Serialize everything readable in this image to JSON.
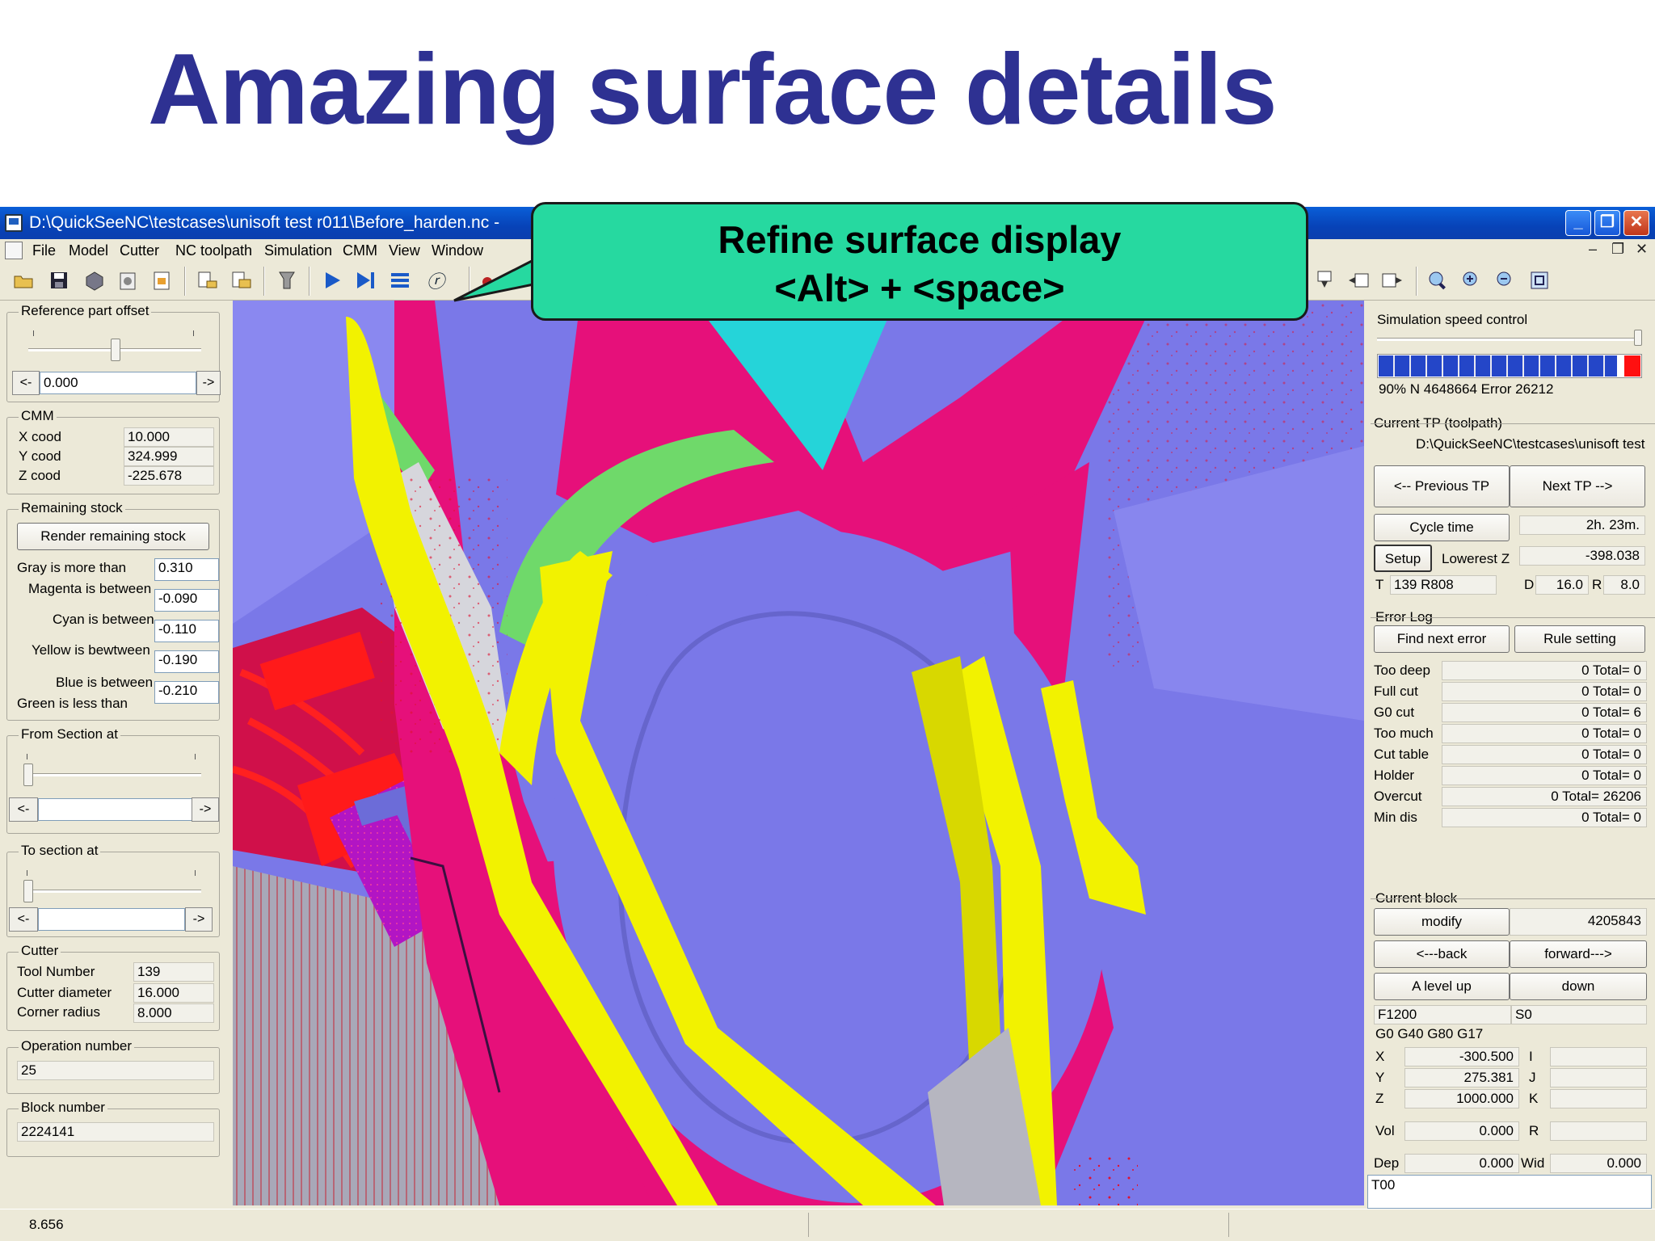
{
  "slide": {
    "title": "Amazing surface details"
  },
  "window": {
    "title": "D:\\QuickSeeNC\\testcases\\unisoft test r011\\Before_harden.nc -",
    "controls": {
      "minimize": "_",
      "restore": "❐",
      "close": "✕"
    }
  },
  "menu": [
    "File",
    "Model",
    "Cutter",
    "NC toolpath",
    "Simulation",
    "CMM",
    "View",
    "Window"
  ],
  "mdi_controls": {
    "minimize": "–",
    "restore": "❐",
    "close": "✕"
  },
  "callout": {
    "line1": "Refine surface display",
    "line2": "<Alt> + <space>"
  },
  "left": {
    "ref_offset": {
      "title": "Reference part offset",
      "value": "0.000",
      "left_arrow": "<-",
      "right_arrow": "->"
    },
    "cmm": {
      "title": "CMM",
      "rows": [
        {
          "label": "X cood",
          "value": "10.000"
        },
        {
          "label": "Y cood",
          "value": "324.999"
        },
        {
          "label": "Z cood",
          "value": "-225.678"
        }
      ]
    },
    "remaining": {
      "title": "Remaining stock",
      "button": "Render remaining stock",
      "rows": [
        {
          "label": "Gray is more than",
          "value": "0.310"
        },
        {
          "label": "Magenta is between",
          "value": "-0.090"
        },
        {
          "label": "Cyan is between",
          "value": "-0.110"
        },
        {
          "label": "Yellow is bewtween",
          "value": "-0.190"
        },
        {
          "label": "Blue is between",
          "value": "-0.210"
        },
        {
          "label": "Green is less than",
          "value": ""
        }
      ]
    },
    "from_section": {
      "title": "From Section at",
      "left_arrow": "<-",
      "right_arrow": "->"
    },
    "to_section": {
      "title": "To section at",
      "left_arrow": "<-",
      "right_arrow": "->"
    },
    "cutter": {
      "title": "Cutter",
      "rows": [
        {
          "label": "Tool Number",
          "value": "139"
        },
        {
          "label": "Cutter diameter",
          "value": "16.000"
        },
        {
          "label": "Corner radius",
          "value": "8.000"
        }
      ]
    },
    "operation": {
      "title": "Operation number",
      "value": "25"
    },
    "block": {
      "title": "Block number",
      "value": "2224141"
    }
  },
  "right": {
    "speed": {
      "title": "Simulation speed control",
      "status": "90%  N 4648664  Error 26212",
      "progress": 0.97
    },
    "current_tp": {
      "title": "Current TP (toolpath)",
      "path": "D:\\QuickSeeNC\\testcases\\unisoft test",
      "prev": "<-- Previous TP",
      "next": "Next TP -->"
    },
    "cycle_time": {
      "label": "Cycle time",
      "value": "2h. 23m."
    },
    "setup": "Setup",
    "lowest_z": {
      "label": "Lowerest Z",
      "value": "-398.038"
    },
    "tool_info": {
      "t": "T",
      "tool": "139  R808",
      "d_label": "D",
      "d": "16.0",
      "r_label": "R",
      "r": "8.0"
    },
    "error_log": {
      "title": "Error Log",
      "find": "Find next error",
      "rule": "Rule setting",
      "rows": [
        {
          "label": "Too deep",
          "value": "0 Total= 0"
        },
        {
          "label": "Full cut",
          "value": "0 Total= 0"
        },
        {
          "label": "G0 cut",
          "value": "0 Total= 6"
        },
        {
          "label": "Too much",
          "value": "0 Total= 0"
        },
        {
          "label": "Cut table",
          "value": "0 Total= 0"
        },
        {
          "label": "Holder",
          "value": "0 Total= 0"
        },
        {
          "label": "Overcut",
          "value": "0 Total= 26206"
        },
        {
          "label": "Min dis",
          "value": "0 Total= 0"
        }
      ]
    },
    "current_block": {
      "title": "Current block",
      "modify": "modify",
      "value": "4205843",
      "back": "<---back",
      "forward": "forward--->",
      "up": "A level up",
      "down": "down",
      "feed": "F1200",
      "speed": "S0",
      "gcodes": "G0  G40  G80  G17",
      "coords": [
        {
          "axis": "X",
          "value": "-300.500",
          "aux": "I"
        },
        {
          "axis": "Y",
          "value": "275.381",
          "aux": "J"
        },
        {
          "axis": "Z",
          "value": "1000.000",
          "aux": "K"
        }
      ],
      "vol_label": "Vol",
      "vol": "0.000",
      "r_label": "R",
      "dep_label": "Dep",
      "dep": "0.000",
      "wid_label": "Wid",
      "wid": "0.000",
      "tool_text": "T00"
    }
  },
  "status": {
    "value": "8.656"
  },
  "colors": {
    "title": "#2e3192",
    "callout": "#26d9a0",
    "magenta": "#e6107a",
    "yellow": "#f2f200",
    "blue": "#7a78e8",
    "green": "#6fd96a",
    "cyan": "#25d4d9"
  }
}
